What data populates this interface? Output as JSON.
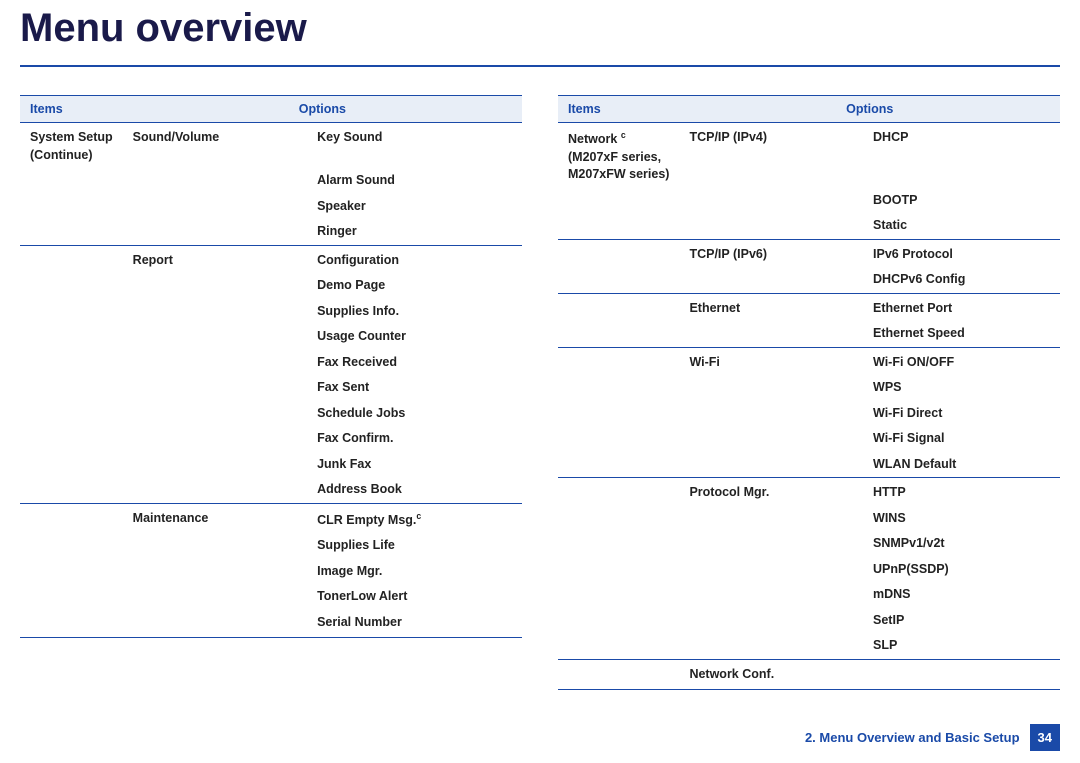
{
  "title": "Menu overview",
  "footer": {
    "chapter": "2. Menu Overview and Basic Setup",
    "page": "34"
  },
  "headers": {
    "items": "Items",
    "options": "Options"
  },
  "left": {
    "item_main": "System Setup",
    "item_sub": "(Continue)",
    "groups": [
      {
        "sub": "Sound/Volume",
        "opts": [
          "Key Sound",
          "Alarm Sound",
          "Speaker",
          "Ringer"
        ]
      },
      {
        "sub": "Report",
        "opts": [
          "Configuration",
          "Demo Page",
          "Supplies Info.",
          "Usage Counter",
          "Fax Received",
          "Fax Sent",
          "Schedule Jobs",
          "Fax Confirm.",
          "Junk Fax",
          "Address Book"
        ]
      },
      {
        "sub": "Maintenance",
        "opts": [
          "CLR Empty Msg.",
          "Supplies Life",
          "Image Mgr.",
          "TonerLow Alert",
          "Serial Number"
        ]
      }
    ]
  },
  "right": {
    "item_main": "Network",
    "item_sub1": "(M207xF series,",
    "item_sub2": "M207xFW series)",
    "groups": [
      {
        "sub": "TCP/IP (IPv4)",
        "opts": [
          "DHCP",
          "BOOTP",
          "Static"
        ]
      },
      {
        "sub": "TCP/IP (IPv6)",
        "opts": [
          "IPv6 Protocol",
          "DHCPv6 Config"
        ]
      },
      {
        "sub": "Ethernet",
        "opts": [
          "Ethernet Port",
          "Ethernet Speed"
        ]
      },
      {
        "sub": "Wi-Fi",
        "opts": [
          "Wi-Fi ON/OFF",
          "WPS",
          "Wi-Fi Direct",
          "Wi-Fi Signal",
          "WLAN Default"
        ]
      },
      {
        "sub": "Protocol Mgr.",
        "opts": [
          "HTTP",
          "WINS",
          "SNMPv1/v2t",
          "UPnP(SSDP)",
          "mDNS",
          "SetIP",
          "SLP"
        ]
      },
      {
        "sub": "Network Conf.",
        "opts": [
          ""
        ]
      }
    ]
  },
  "sup_c": "c"
}
